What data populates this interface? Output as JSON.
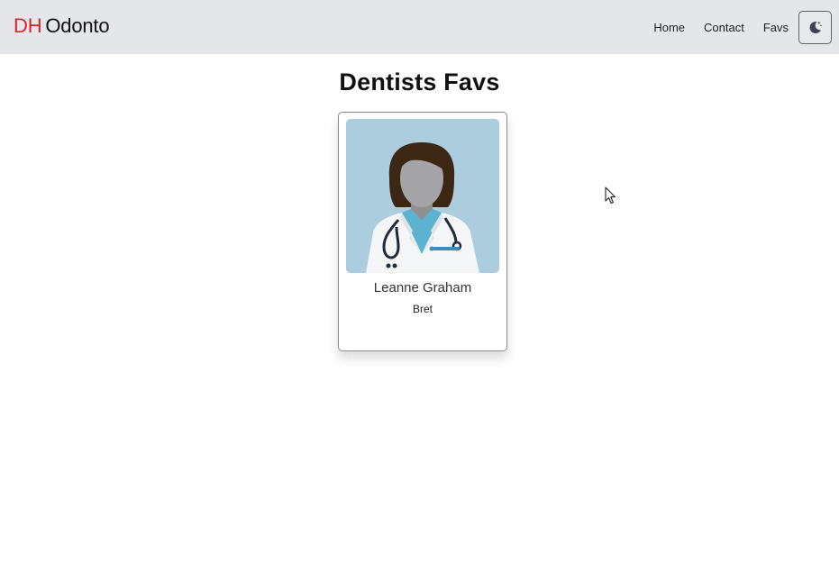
{
  "brand": {
    "part1": "DH",
    "part2": "Odonto",
    "part1_color": "#d4262e"
  },
  "nav": {
    "links": [
      {
        "label": "Home"
      },
      {
        "label": "Contact"
      },
      {
        "label": "Favs"
      }
    ],
    "theme_toggle_icon": "moon-icon"
  },
  "page": {
    "title": "Dentists Favs"
  },
  "favorites": [
    {
      "name": "Leanne Graham",
      "username": "Bret",
      "image_icon": "doctor-avatar-icon"
    }
  ],
  "colors": {
    "navbar_bg": "#e5e6ea",
    "avatar_bg": "#abcddd"
  }
}
